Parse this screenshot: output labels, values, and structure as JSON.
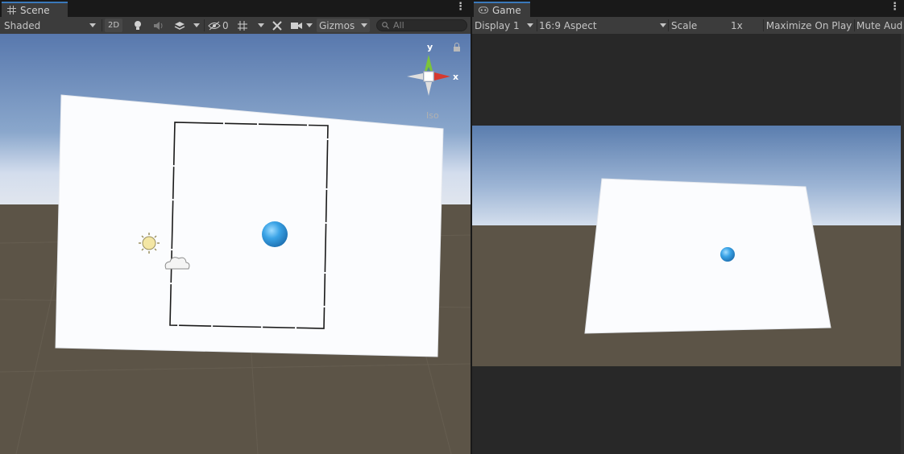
{
  "scene_tab": {
    "icon": "grid-icon",
    "title": "Scene",
    "toolbar": {
      "draw_mode": "Shaded",
      "mode_2d": "2D",
      "hidden_count": "0",
      "gizmos": "Gizmos",
      "search_placeholder": "All"
    },
    "gizmo_axes": {
      "y": "y",
      "x": "x"
    },
    "projection_label": "Iso"
  },
  "game_tab": {
    "icon": "gamepad-icon",
    "title": "Game",
    "toolbar": {
      "display": "Display 1",
      "aspect": "16:9 Aspect",
      "scale_label": "Scale",
      "scale_value": "1x",
      "maximize": "Maximize On Play",
      "mute": "Mute Aud"
    }
  },
  "colors": {
    "accent": "#3a79bb",
    "sky_top": "#5a7dae",
    "horizon": "#c9d8ea",
    "ground": "#5c5447",
    "sphere": "#3aa3e6"
  }
}
